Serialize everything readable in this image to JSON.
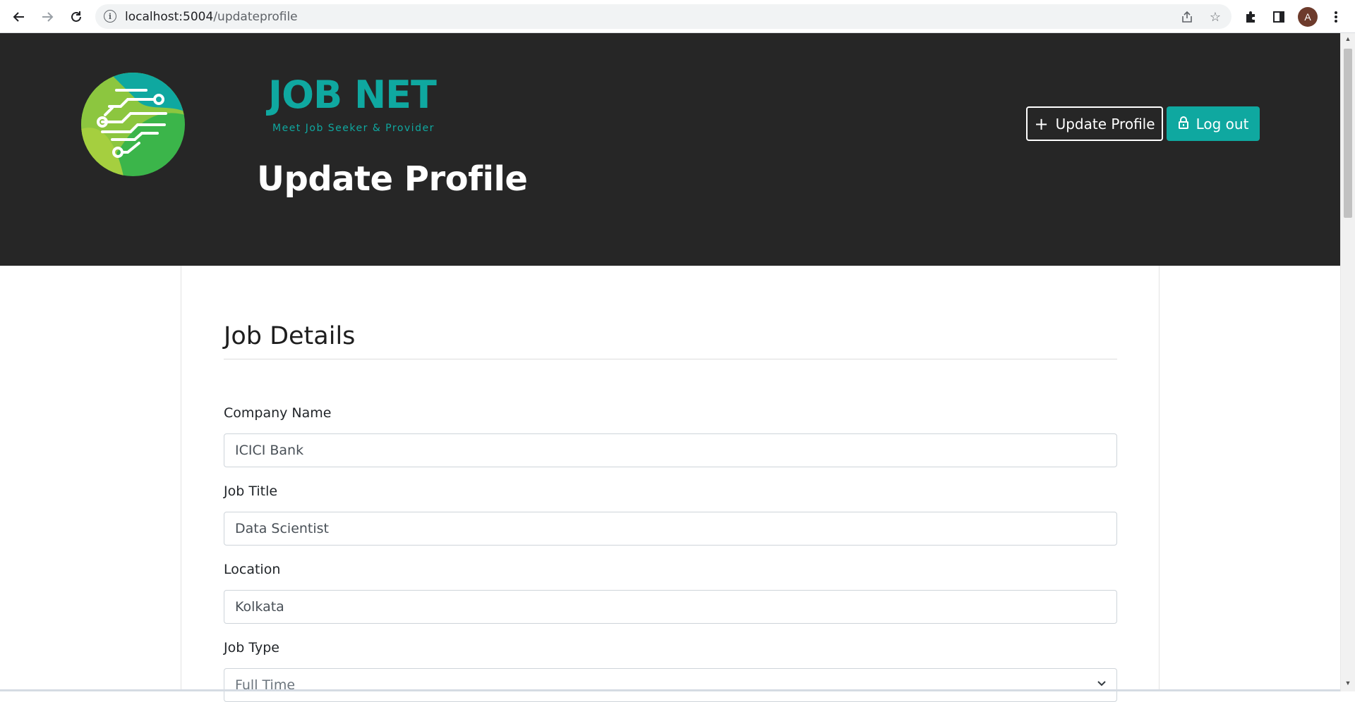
{
  "browser": {
    "url_host": "localhost:5004",
    "url_path": "/updateprofile",
    "avatar_letter": "A"
  },
  "header": {
    "brand_name": "JOB NET",
    "tagline": "Meet Job Seeker & Provider",
    "page_title": "Update Profile",
    "update_profile_label": "Update Profile",
    "logout_label": "Log out",
    "brand_color": "#0fa8a0",
    "background_color": "#262626"
  },
  "form": {
    "section_title": "Job Details",
    "company_name_label": "Company Name",
    "company_name_value": "ICICI Bank",
    "job_title_label": "Job Title",
    "job_title_value": "Data Scientist",
    "location_label": "Location",
    "location_value": "Kolkata",
    "job_type_label": "Job Type",
    "job_type_value": "Full Time"
  }
}
